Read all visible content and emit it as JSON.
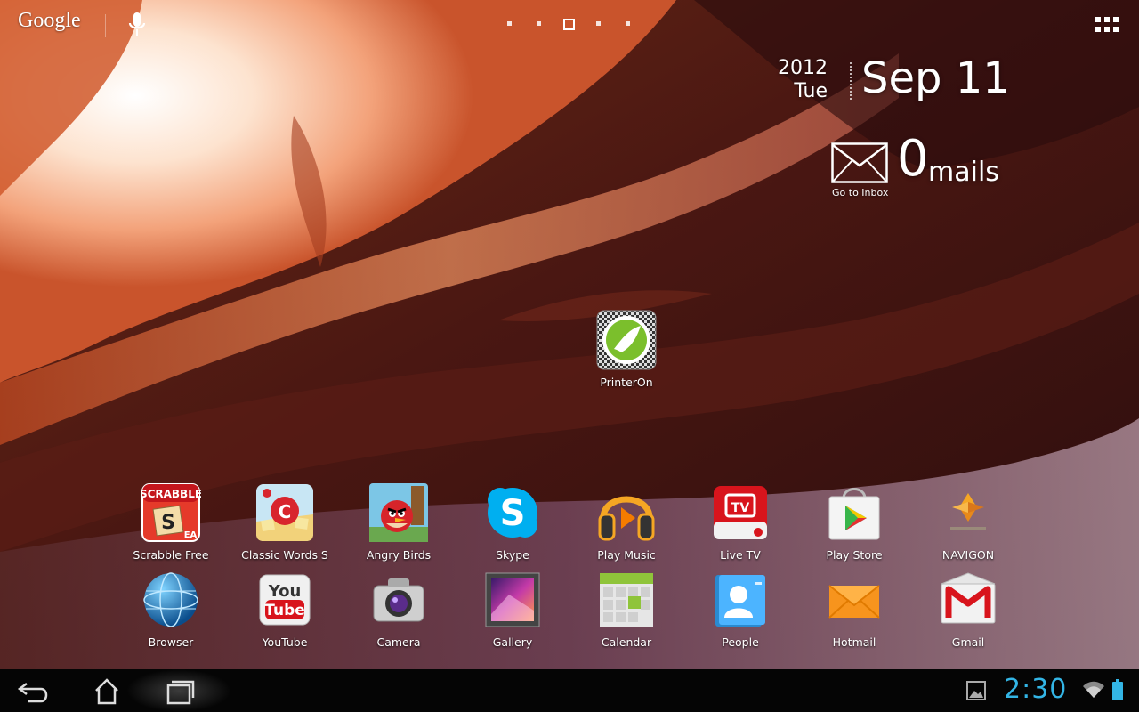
{
  "search": {
    "label": "Google"
  },
  "home_pages": {
    "count": 5,
    "active_index": 2
  },
  "date_widget": {
    "year": "2012",
    "day_of_week": "Tue",
    "month_day": "Sep 11"
  },
  "mail_widget": {
    "count": "0",
    "unit": "mails",
    "go_to_inbox": "Go to Inbox"
  },
  "desktop_apps": [
    {
      "label": "PrinterOn",
      "icon": "printeron-icon"
    }
  ],
  "app_rows": [
    [
      {
        "label": "Scrabble Free",
        "icon": "scrabble-icon"
      },
      {
        "label": "Classic Words S",
        "icon": "classic-words-icon"
      },
      {
        "label": "Angry Birds",
        "icon": "angry-birds-icon"
      },
      {
        "label": "Skype",
        "icon": "skype-icon"
      },
      {
        "label": "Play Music",
        "icon": "play-music-icon"
      },
      {
        "label": "Live TV",
        "icon": "live-tv-icon"
      },
      {
        "label": "Play Store",
        "icon": "play-store-icon"
      },
      {
        "label": "NAVIGON",
        "icon": "navigon-icon"
      }
    ],
    [
      {
        "label": "Browser",
        "icon": "browser-icon"
      },
      {
        "label": "YouTube",
        "icon": "youtube-icon"
      },
      {
        "label": "Camera",
        "icon": "camera-icon"
      },
      {
        "label": "Gallery",
        "icon": "gallery-icon"
      },
      {
        "label": "Calendar",
        "icon": "calendar-icon"
      },
      {
        "label": "People",
        "icon": "people-icon"
      },
      {
        "label": "Hotmail",
        "icon": "hotmail-icon"
      },
      {
        "label": "Gmail",
        "icon": "gmail-icon"
      }
    ]
  ],
  "status_bar": {
    "time": "2:30"
  },
  "colors": {
    "clock": "#33b5e5",
    "navbar": "#050505"
  }
}
